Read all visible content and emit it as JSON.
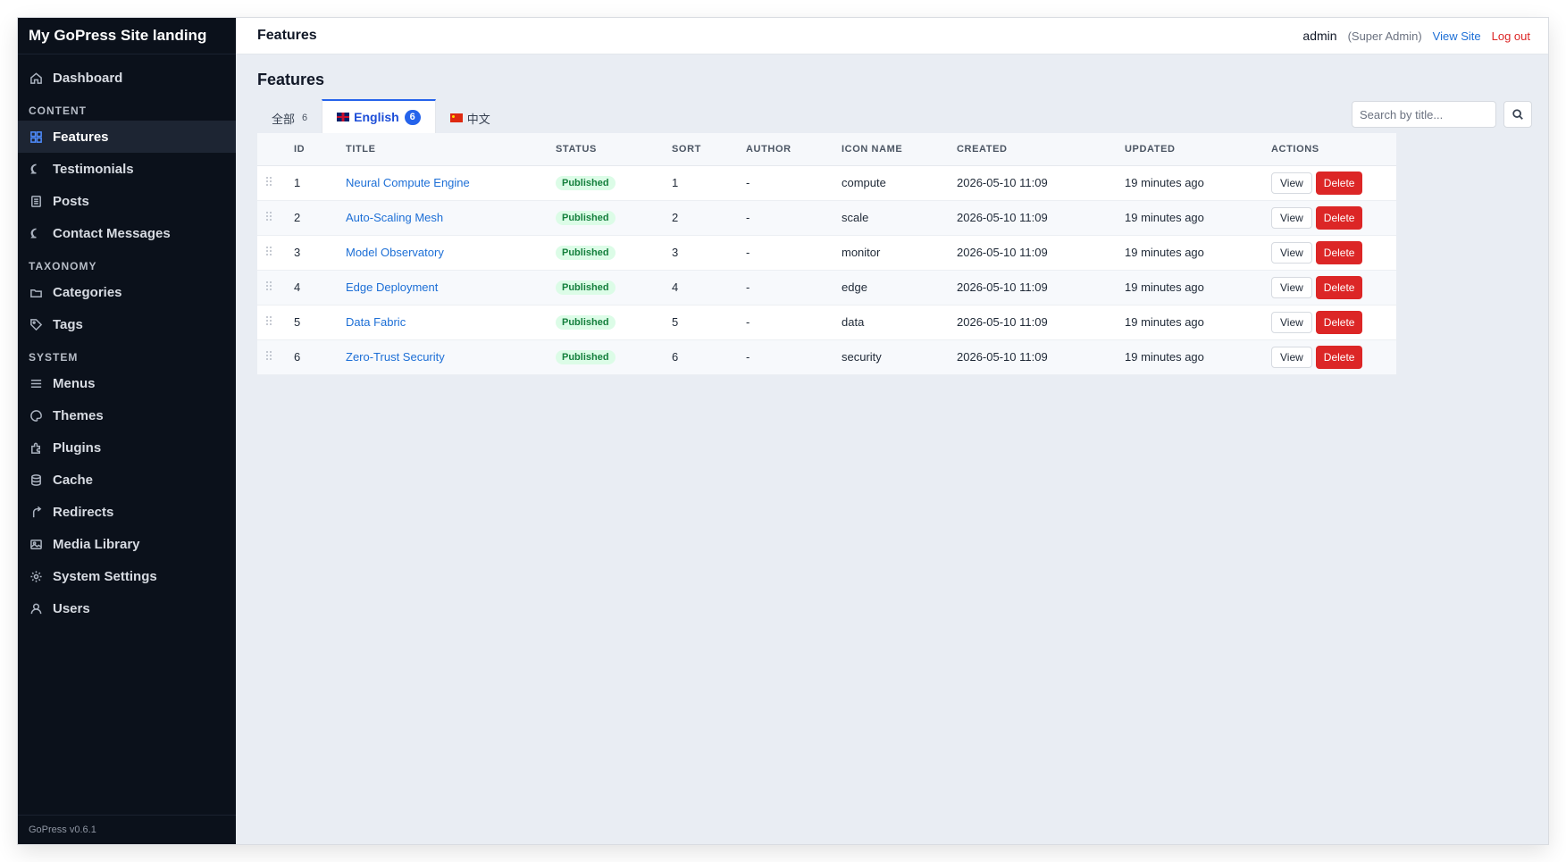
{
  "brand": "My GoPress Site landing",
  "sidebar": {
    "top_items": [
      {
        "label": "Dashboard",
        "icon": "home-icon"
      }
    ],
    "content_header": "CONTENT",
    "content_items": [
      {
        "label": "Features",
        "icon": "grid-icon",
        "active": true
      },
      {
        "label": "Testimonials",
        "icon": "chat-bubble-icon"
      },
      {
        "label": "Posts",
        "icon": "document-icon"
      },
      {
        "label": "Contact Messages",
        "icon": "chat-bubble-icon"
      }
    ],
    "taxonomy_header": "TAXONOMY",
    "taxonomy_items": [
      {
        "label": "Categories",
        "icon": "folder-icon"
      },
      {
        "label": "Tags",
        "icon": "tag-icon"
      }
    ],
    "system_header": "SYSTEM",
    "system_items": [
      {
        "label": "Menus",
        "icon": "menu-icon"
      },
      {
        "label": "Themes",
        "icon": "palette-icon"
      },
      {
        "label": "Plugins",
        "icon": "puzzle-icon"
      },
      {
        "label": "Cache",
        "icon": "database-icon"
      },
      {
        "label": "Redirects",
        "icon": "redirect-icon"
      },
      {
        "label": "Media Library",
        "icon": "image-icon"
      },
      {
        "label": "System Settings",
        "icon": "gear-icon"
      },
      {
        "label": "Users",
        "icon": "user-icon"
      }
    ],
    "version": "GoPress v0.6.1"
  },
  "topbar": {
    "title": "Features",
    "user": "admin",
    "role": "(Super Admin)",
    "view_site": "View Site",
    "logout": "Log out"
  },
  "page": {
    "title": "Features",
    "tabs": [
      {
        "label": "全部",
        "count": "6"
      },
      {
        "label": "English",
        "count": "6",
        "active": true
      },
      {
        "label": "中文"
      }
    ],
    "search_placeholder": "Search by title..."
  },
  "table": {
    "headers": [
      "ID",
      "TITLE",
      "STATUS",
      "SORT",
      "AUTHOR",
      "ICON NAME",
      "CREATED",
      "UPDATED",
      "ACTIONS"
    ],
    "view_label": "View",
    "delete_label": "Delete",
    "rows": [
      {
        "id": "1",
        "title": "Neural Compute Engine",
        "status": "Published",
        "sort": "1",
        "author": "-",
        "icon_name": "compute",
        "created": "2026-05-10 11:09",
        "updated": "19 minutes ago"
      },
      {
        "id": "2",
        "title": "Auto-Scaling Mesh",
        "status": "Published",
        "sort": "2",
        "author": "-",
        "icon_name": "scale",
        "created": "2026-05-10 11:09",
        "updated": "19 minutes ago"
      },
      {
        "id": "3",
        "title": "Model Observatory",
        "status": "Published",
        "sort": "3",
        "author": "-",
        "icon_name": "monitor",
        "created": "2026-05-10 11:09",
        "updated": "19 minutes ago"
      },
      {
        "id": "4",
        "title": "Edge Deployment",
        "status": "Published",
        "sort": "4",
        "author": "-",
        "icon_name": "edge",
        "created": "2026-05-10 11:09",
        "updated": "19 minutes ago"
      },
      {
        "id": "5",
        "title": "Data Fabric",
        "status": "Published",
        "sort": "5",
        "author": "-",
        "icon_name": "data",
        "created": "2026-05-10 11:09",
        "updated": "19 minutes ago"
      },
      {
        "id": "6",
        "title": "Zero-Trust Security",
        "status": "Published",
        "sort": "6",
        "author": "-",
        "icon_name": "security",
        "created": "2026-05-10 11:09",
        "updated": "19 minutes ago"
      }
    ]
  },
  "colors": {
    "sidebar_bg": "#0b111b",
    "accent": "#2563eb",
    "link": "#1d6fd6",
    "danger": "#dc2626",
    "success_bg": "#dcfce7",
    "success_text": "#15803d"
  }
}
